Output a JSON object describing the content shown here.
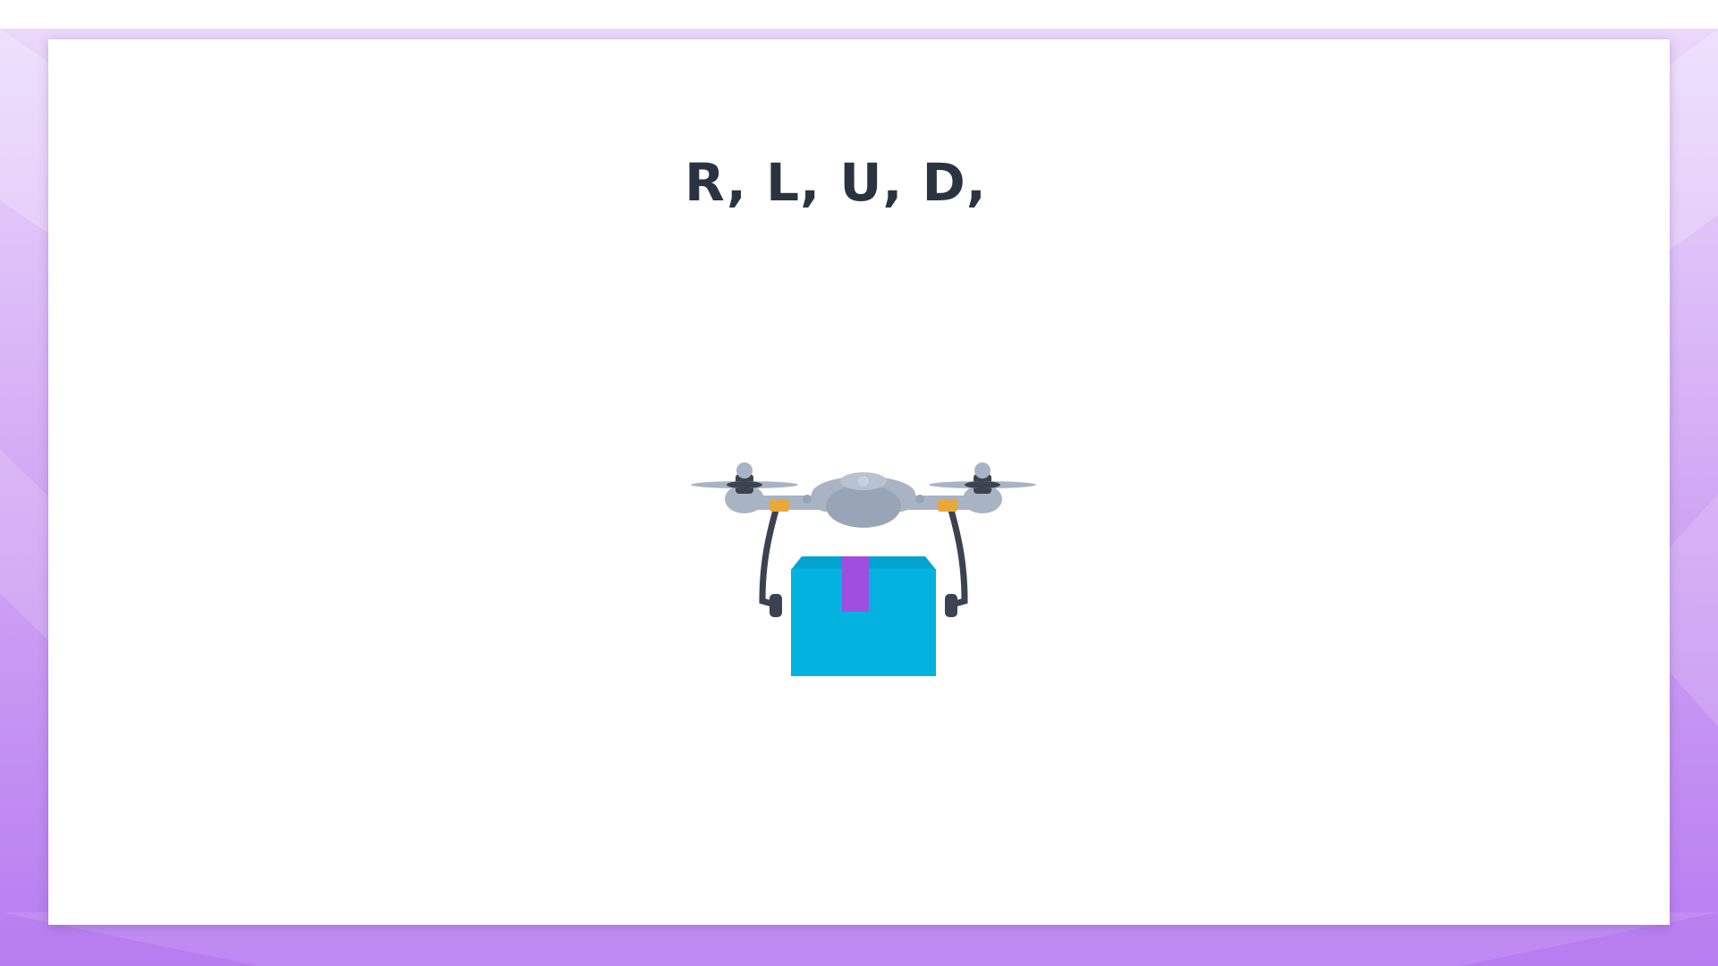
{
  "slide": {
    "heading": "R, L, U, D,"
  },
  "illustration": {
    "name": "delivery-drone",
    "icon": "drone-carrying-package-icon",
    "colors": {
      "drone_body": "#a8b4c4",
      "drone_dark": "#3b4350",
      "motor_accent": "#e8a83a",
      "package": "#04b2e0",
      "package_tape": "#a04ee0"
    }
  },
  "theme": {
    "frame_gradient_top": "#ead8fb",
    "frame_gradient_bottom": "#b77cf0",
    "slide_background": "#ffffff",
    "text_color": "#2a3440"
  }
}
